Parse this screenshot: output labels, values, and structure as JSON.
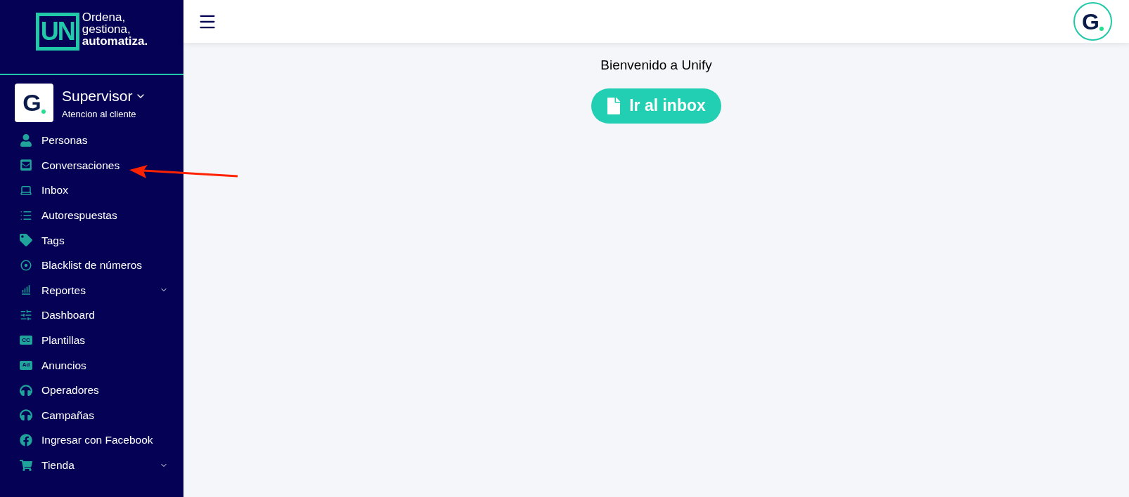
{
  "sidebar": {
    "logo": {
      "mark": "UN",
      "tagline_lines": [
        "Ordena,",
        "gestiona,"
      ],
      "tagline_bold": "automatiza."
    },
    "profile": {
      "avatar": "G",
      "role": "Supervisor",
      "team": "Atencion al cliente"
    },
    "items": [
      {
        "label": "Personas"
      },
      {
        "label": "Conversaciones"
      },
      {
        "label": "Inbox"
      },
      {
        "label": "Autorespuestas"
      },
      {
        "label": "Tags"
      },
      {
        "label": "Blacklist de números"
      },
      {
        "label": "Reportes",
        "expanded": false
      },
      {
        "label": "Dashboard"
      },
      {
        "label": "Plantillas",
        "badge": "CC"
      },
      {
        "label": "Anuncios",
        "badge": "Ad"
      },
      {
        "label": "Operadores"
      },
      {
        "label": "Campañas"
      },
      {
        "label": "Ingresar con Facebook"
      },
      {
        "label": "Tienda",
        "expanded": false
      }
    ]
  },
  "topbar": {
    "avatar": "G"
  },
  "main": {
    "welcome": "Bienvenido a Unify",
    "button": "Ir al inbox"
  }
}
